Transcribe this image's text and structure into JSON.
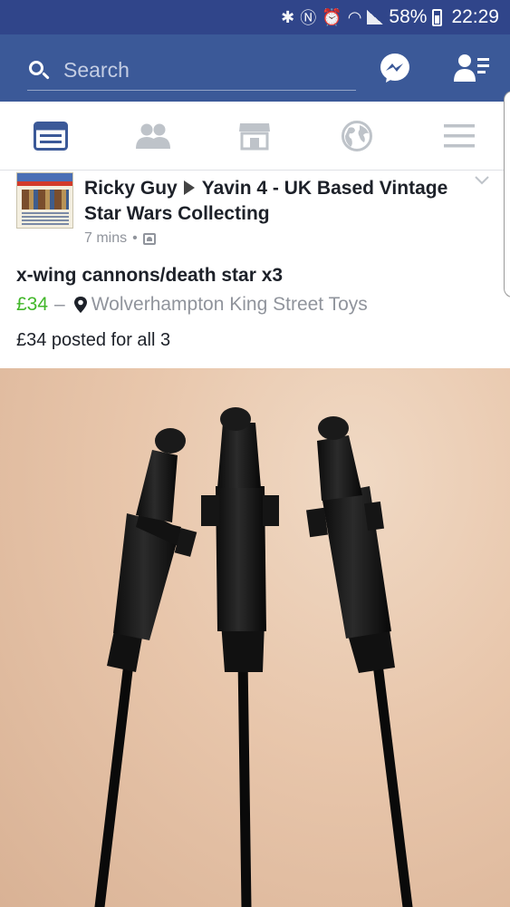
{
  "status_bar": {
    "battery": "58%",
    "time": "22:29"
  },
  "header": {
    "search_placeholder": "Search"
  },
  "post": {
    "author": "Ricky Guy",
    "group": "Yavin 4 - UK Based Vintage Star Wars Collecting",
    "time": "7 mins",
    "separator": "•",
    "item_title": "x-wing cannons/death star x3",
    "price": "£34",
    "dash": "–",
    "location": "Wolverhampton King Street Toys",
    "text": "£34 posted for all 3"
  },
  "colors": {
    "status_bar": "#30458a",
    "header": "#3b5998",
    "tab_active": "#3b5998",
    "tab_inactive": "#bec3c9",
    "price": "#42b72a",
    "meta": "#90949c"
  }
}
